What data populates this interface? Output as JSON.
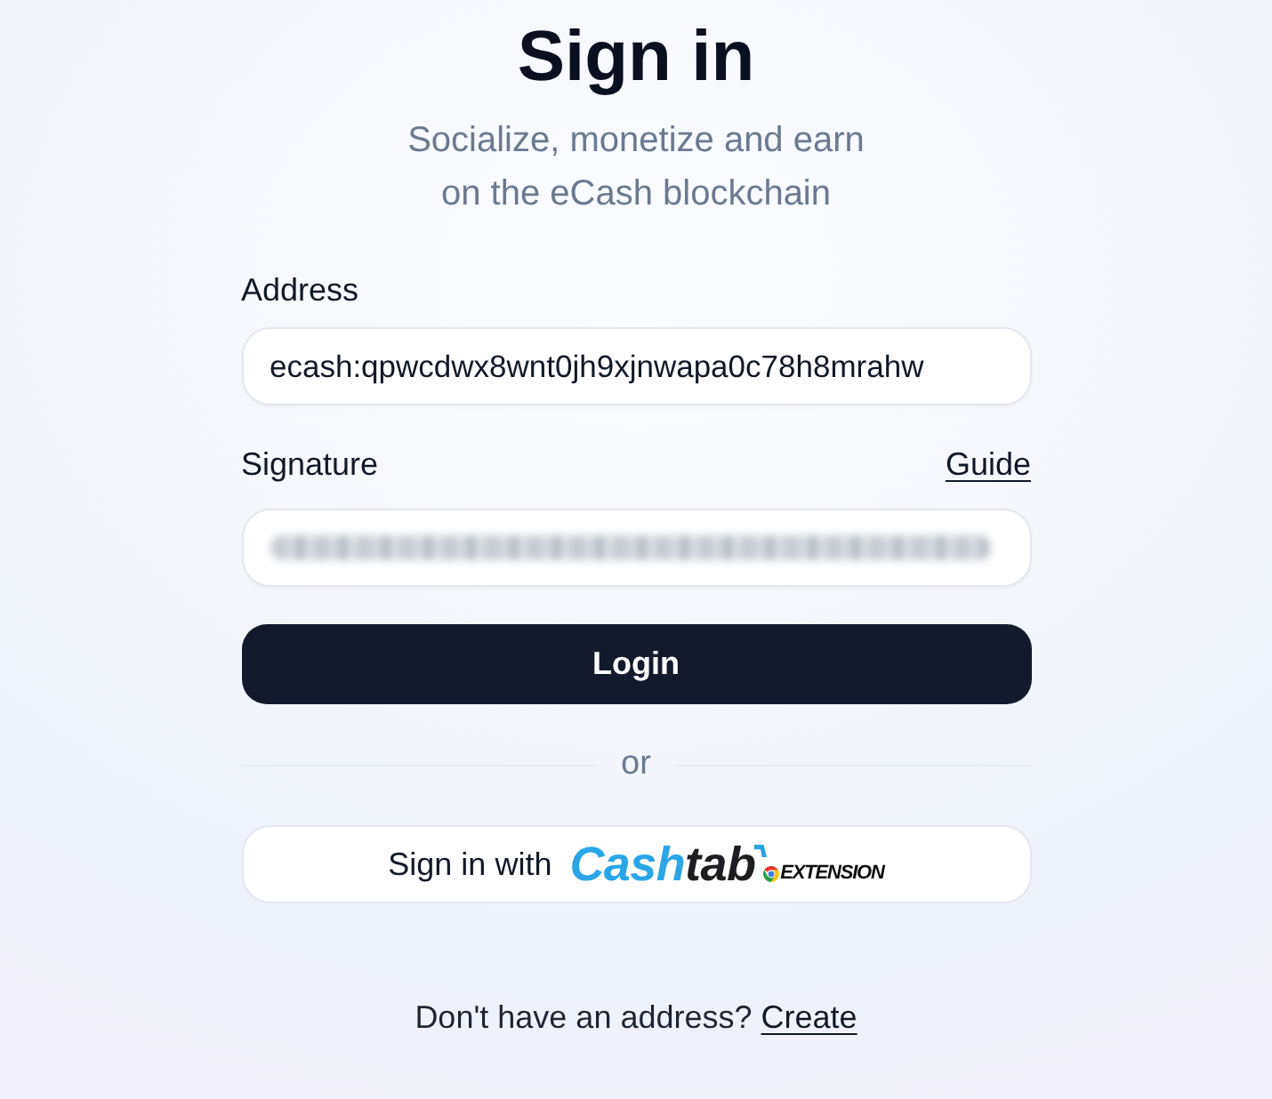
{
  "title": "Sign in",
  "subtitle": "Socialize, monetize and earn on the eCash blockchain",
  "form": {
    "address": {
      "label": "Address",
      "value": "ecash:qpwcdwx8wnt0jh9xjnwapa0c78h8mrahw"
    },
    "signature": {
      "label": "Signature",
      "link": "Guide",
      "blurred": true
    },
    "submit": "Login",
    "separator": "or",
    "alt_signin": {
      "prefix": "Sign in with",
      "brand": [
        "Cash",
        "tab"
      ],
      "badge": "EXTENSION"
    }
  },
  "footer": {
    "text": "Don't have an address?",
    "link": "Create"
  }
}
